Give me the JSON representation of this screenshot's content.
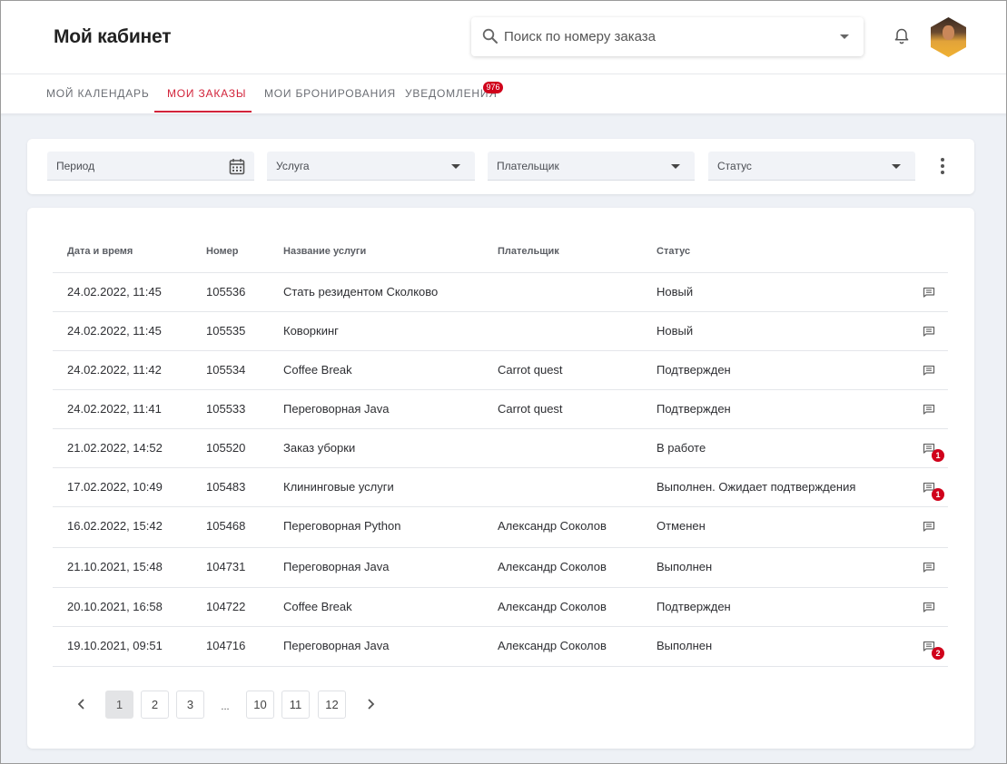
{
  "header": {
    "title": "Мой кабинет",
    "search_placeholder": "Поиск по номеру заказа"
  },
  "tabs": [
    {
      "label": "Мой календарь",
      "active": false
    },
    {
      "label": "Мои заказы",
      "active": true
    },
    {
      "label": "Мои бронирования",
      "active": false
    },
    {
      "label": "Уведомления",
      "active": false,
      "badge": "976"
    }
  ],
  "filters": {
    "period": "Период",
    "service": "Услуга",
    "payer": "Плательщик",
    "status": "Статус"
  },
  "table": {
    "headers": [
      "Дата и время",
      "Номер",
      "Название услуги",
      "Плательщик",
      "Статус"
    ],
    "rows": [
      {
        "date": "24.02.2022, 11:45",
        "number": "105536",
        "service": "Стать резидентом Сколково",
        "payer": "",
        "status": "Новый",
        "messages": ""
      },
      {
        "date": "24.02.2022, 11:45",
        "number": "105535",
        "service": "Коворкинг",
        "payer": "",
        "status": "Новый",
        "messages": ""
      },
      {
        "date": "24.02.2022, 11:42",
        "number": "105534",
        "service": "Coffee Break",
        "payer": "Carrot quest",
        "status": "Подтвержден",
        "messages": ""
      },
      {
        "date": "24.02.2022, 11:41",
        "number": "105533",
        "service": "Переговорная Java",
        "payer": "Carrot quest",
        "status": "Подтвержден",
        "messages": ""
      },
      {
        "date": "21.02.2022, 14:52",
        "number": "105520",
        "service": "Заказ уборки",
        "payer": "",
        "status": "В работе",
        "messages": "1"
      },
      {
        "date": "17.02.2022, 10:49",
        "number": "105483",
        "service": "Клининговые услуги",
        "payer": "",
        "status": "Выполнен. Ожидает подтверждения",
        "messages": "1"
      },
      {
        "date": "16.02.2022, 15:42",
        "number": "105468",
        "service": "Переговорная Python",
        "payer": "Александр Соколов",
        "status": "Отменен",
        "messages": ""
      },
      {
        "date": "21.10.2021, 15:48",
        "number": "104731",
        "service": "Переговорная Java",
        "payer": "Александр Соколов",
        "status": "Выполнен",
        "messages": ""
      },
      {
        "date": "20.10.2021, 16:58",
        "number": "104722",
        "service": "Coffee Break",
        "payer": "Александр Соколов",
        "status": "Подтвержден",
        "messages": ""
      },
      {
        "date": "19.10.2021, 09:51",
        "number": "104716",
        "service": "Переговорная Java",
        "payer": "Александр Соколов",
        "status": "Выполнен",
        "messages": "2"
      }
    ]
  },
  "pagination": {
    "pages": [
      "1",
      "2",
      "3",
      "...",
      "10",
      "11",
      "12"
    ],
    "current": "1"
  },
  "colors": {
    "accent": "#d2233a",
    "badge": "#d0021b",
    "background": "#eef1f6"
  }
}
